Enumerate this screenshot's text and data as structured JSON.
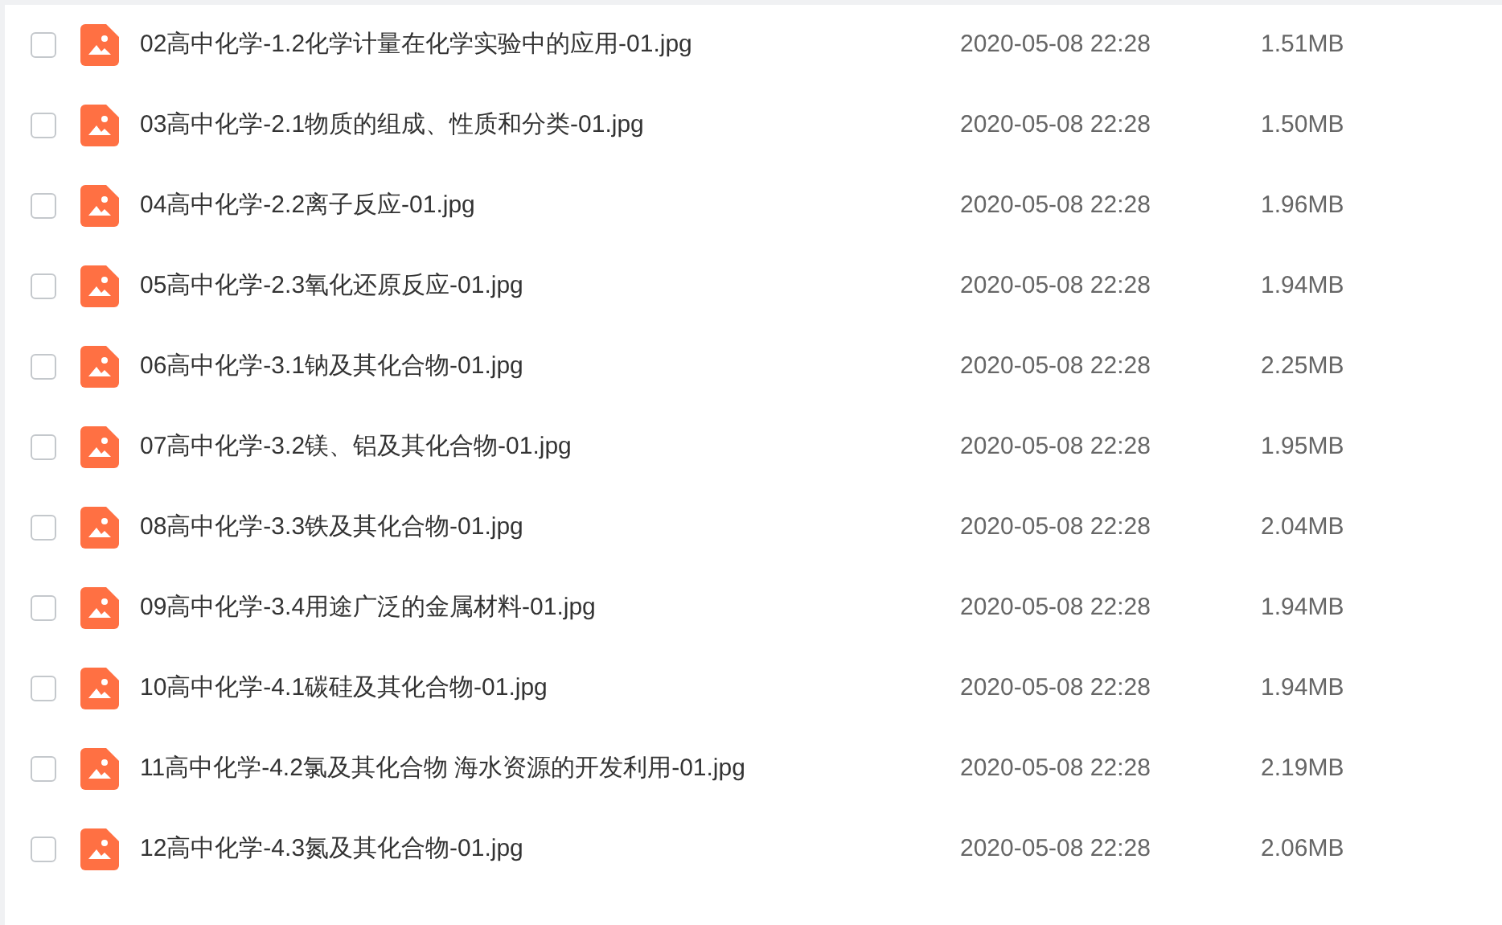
{
  "files": [
    {
      "name": "02高中化学-1.2化学计量在化学实验中的应用-01.jpg",
      "date": "2020-05-08 22:28",
      "size": "1.51MB",
      "checked": false
    },
    {
      "name": "03高中化学-2.1物质的组成、性质和分类-01.jpg",
      "date": "2020-05-08 22:28",
      "size": "1.50MB",
      "checked": false
    },
    {
      "name": "04高中化学-2.2离子反应-01.jpg",
      "date": "2020-05-08 22:28",
      "size": "1.96MB",
      "checked": false
    },
    {
      "name": "05高中化学-2.3氧化还原反应-01.jpg",
      "date": "2020-05-08 22:28",
      "size": "1.94MB",
      "checked": false
    },
    {
      "name": "06高中化学-3.1钠及其化合物-01.jpg",
      "date": "2020-05-08 22:28",
      "size": "2.25MB",
      "checked": false
    },
    {
      "name": "07高中化学-3.2镁、铝及其化合物-01.jpg",
      "date": "2020-05-08 22:28",
      "size": "1.95MB",
      "checked": false
    },
    {
      "name": "08高中化学-3.3铁及其化合物-01.jpg",
      "date": "2020-05-08 22:28",
      "size": "2.04MB",
      "checked": false
    },
    {
      "name": "09高中化学-3.4用途广泛的金属材料-01.jpg",
      "date": "2020-05-08 22:28",
      "size": "1.94MB",
      "checked": false
    },
    {
      "name": "10高中化学-4.1碳硅及其化合物-01.jpg",
      "date": "2020-05-08 22:28",
      "size": "1.94MB",
      "checked": false
    },
    {
      "name": "11高中化学-4.2氯及其化合物 海水资源的开发利用-01.jpg",
      "date": "2020-05-08 22:28",
      "size": "2.19MB",
      "checked": false
    },
    {
      "name": "12高中化学-4.3氮及其化合物-01.jpg",
      "date": "2020-05-08 22:28",
      "size": "2.06MB",
      "checked": false
    }
  ]
}
